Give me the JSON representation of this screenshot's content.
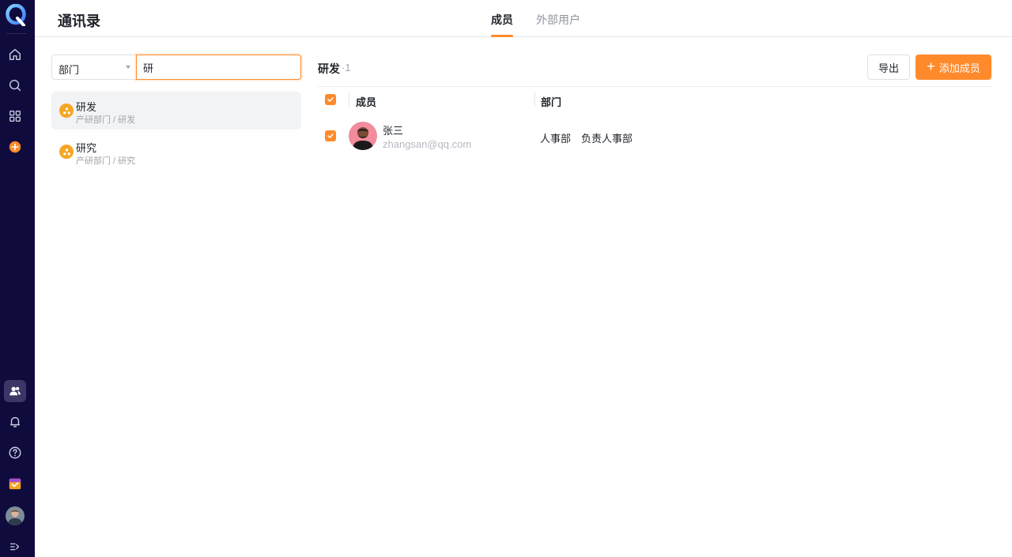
{
  "sidebar": {
    "logo_letter": "Q",
    "icons": [
      "home-icon",
      "search-icon",
      "apps-grid-icon",
      "add-circle-icon",
      "contacts-icon",
      "bell-icon",
      "help-icon",
      "calendar-app-icon",
      "user-avatar",
      "expand-sidebar-icon"
    ]
  },
  "header": {
    "title": "通讯录",
    "tabs": [
      {
        "label": "成员",
        "active": true
      },
      {
        "label": "外部用户",
        "active": false
      }
    ]
  },
  "left_panel": {
    "filter_select": {
      "value": "部门"
    },
    "search": {
      "value": "研",
      "placeholder": ""
    },
    "departments": [
      {
        "name": "研发",
        "path": "产研部门 / 研发",
        "selected": true
      },
      {
        "name": "研究",
        "path": "产研部门 / 研究",
        "selected": false
      }
    ]
  },
  "right_panel": {
    "title": "研发",
    "count": "·1",
    "export_label": "导出",
    "add_label": "添加成员",
    "table": {
      "headers": {
        "member": "成员",
        "department": "部门"
      },
      "rows": [
        {
          "checked": true,
          "name": "张三",
          "email": "zhangsan@qq.com",
          "departments": [
            "人事部",
            "负责人事部"
          ]
        }
      ]
    }
  },
  "colors": {
    "accent": "#ff8a2b",
    "sidebar_bg": "#0f0b3d",
    "dept_icon": "#f5a623"
  }
}
